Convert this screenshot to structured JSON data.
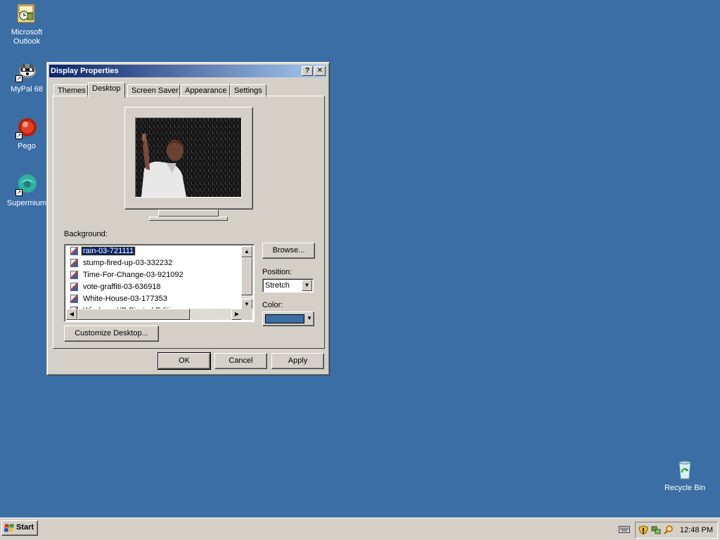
{
  "desktop": {
    "icons": [
      {
        "label_line1": "Microsoft",
        "label_line2": "Outlook",
        "icon": "outlook-icon"
      },
      {
        "label_line1": "MyPal 68",
        "label_line2": "",
        "icon": "mypal-icon"
      },
      {
        "label_line1": "Pego",
        "label_line2": "",
        "icon": "pego-icon"
      },
      {
        "label_line1": "Supermium",
        "label_line2": "",
        "icon": "supermium-icon"
      },
      {
        "label_line1": "Recycle Bin",
        "label_line2": "",
        "icon": "recycle-bin-icon"
      }
    ],
    "background_color": "#3a6ea5"
  },
  "window": {
    "title": "Display Properties",
    "help_glyph": "?",
    "close_glyph": "✕",
    "tabs": [
      {
        "label": "Themes"
      },
      {
        "label": "Desktop"
      },
      {
        "label": "Screen Saver"
      },
      {
        "label": "Appearance"
      },
      {
        "label": "Settings"
      }
    ],
    "active_tab": "Desktop",
    "background_label": "Background:",
    "background_items": [
      {
        "label": "rain-03-721111",
        "selected": true
      },
      {
        "label": "stump-fired-up-03-332232",
        "selected": false
      },
      {
        "label": "Time-For-Change-03-921092",
        "selected": false
      },
      {
        "label": "vote-graffiti-03-636918",
        "selected": false
      },
      {
        "label": "White-House-03-177353",
        "selected": false
      },
      {
        "label": "Windows XP Pirated Edition",
        "selected": false
      }
    ],
    "browse_label": "Browse...",
    "position_label": "Position:",
    "position_value": "Stretch",
    "color_label": "Color:",
    "color_value": "#3a6ea5",
    "customize_label": "Customize Desktop...",
    "ok_label": "OK",
    "cancel_label": "Cancel",
    "apply_label": "Apply"
  },
  "taskbar": {
    "start_label": "Start",
    "clock": "12:48 PM"
  }
}
